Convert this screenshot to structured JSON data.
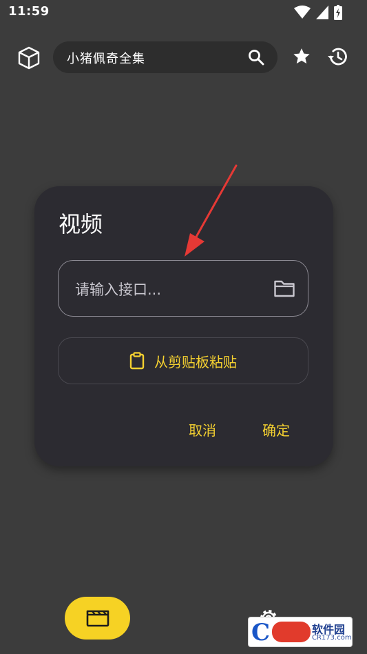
{
  "status_bar": {
    "time": "11:59"
  },
  "search": {
    "query": "小猪佩奇全集"
  },
  "dialog": {
    "title": "视频",
    "input_placeholder": "请输入接口...",
    "paste_label": "从剪贴板粘贴",
    "cancel_label": "取消",
    "confirm_label": "确定"
  },
  "watermark": {
    "title": "软件园",
    "subtitle": "CR173.com"
  },
  "colors": {
    "accent": "#f5d130",
    "dialog_bg": "#2c2b31",
    "page_bg": "#3c3c3c",
    "annotation_arrow": "#e53935"
  },
  "icons": [
    "cube-icon",
    "search-icon",
    "star-icon",
    "history-icon",
    "folder-icon",
    "clipboard-icon",
    "clapperboard-icon",
    "gear-icon",
    "wifi-icon",
    "signal-icon",
    "battery-icon"
  ]
}
